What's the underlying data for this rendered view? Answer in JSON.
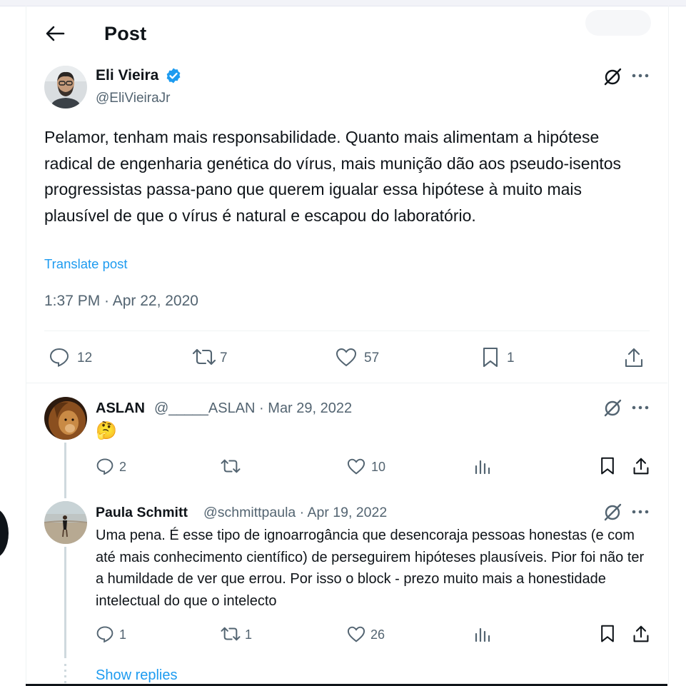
{
  "header": {
    "title": "Post"
  },
  "post": {
    "author_name": "Eli Vieira",
    "author_handle": "@EliVieiraJr",
    "text": "Pelamor, tenham mais responsabilidade. Quanto mais alimentam a hipótese radical de engenharia genética do vírus, mais munição dão aos pseudo-isentos progressistas passa-pano que querem igualar essa hipótese à muito mais plausível de que o vírus é natural e escapou do laboratório.",
    "translate_label": "Translate post",
    "timestamp": "1:37 PM · Apr 22, 2020",
    "stats": {
      "replies": "12",
      "reposts": "7",
      "likes": "57",
      "bookmarks": "1"
    }
  },
  "replies": [
    {
      "name": "ASLAN",
      "meta": "@_____ASLAN · Mar 29, 2022",
      "text": "🤔",
      "stats": {
        "replies": "2",
        "reposts": "",
        "likes": "10"
      }
    },
    {
      "name": "Paula Schmitt",
      "meta": "@schmittpaula · Apr 19, 2022",
      "text": "Uma pena. É esse tipo de ignoarrogância que desencoraja pessoas honestas (e com até mais conhecimento científico) de perseguirem hipóteses plausíveis. Pior foi não ter a humildade de ver que errou. Por isso o block - prezo muito mais a honestidade intelectual do que o intelecto",
      "stats": {
        "replies": "1",
        "reposts": "1",
        "likes": "26"
      }
    }
  ],
  "show_replies_label": "Show replies",
  "colors": {
    "accent": "#1d9bf0",
    "muted": "#536471",
    "text": "#0f1419",
    "thread_line": "#cfd9de"
  },
  "icons": [
    "back-arrow-icon",
    "verified-badge-icon",
    "grok-icon",
    "more-icon",
    "reply-icon",
    "repost-icon",
    "like-icon",
    "bookmark-icon",
    "share-icon",
    "views-icon"
  ]
}
